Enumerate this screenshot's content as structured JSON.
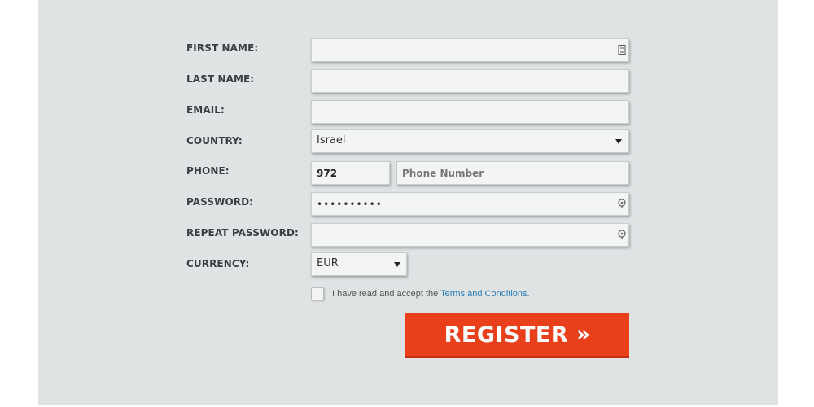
{
  "form": {
    "first_name": {
      "label": "FIRST NAME:",
      "value": ""
    },
    "last_name": {
      "label": "LAST NAME:",
      "value": ""
    },
    "email": {
      "label": "EMAIL:",
      "value": ""
    },
    "country": {
      "label": "COUNTRY:",
      "value": "Israel"
    },
    "phone": {
      "label": "PHONE:",
      "code": "972",
      "placeholder": "Phone Number"
    },
    "password": {
      "label": "PASSWORD:",
      "value": "••••••••••"
    },
    "repeat_password": {
      "label": "REPEAT PASSWORD:",
      "value": ""
    },
    "currency": {
      "label": "CURRENCY:",
      "value": "EUR"
    },
    "terms": {
      "prefix": "I have read and accept the ",
      "link": "Terms and Conditions."
    },
    "register_label": "REGISTER",
    "register_chevron": "»"
  },
  "colors": {
    "accent": "#e93f1a",
    "link": "#2e7db7",
    "panel_bg": "#dfe3e4"
  },
  "icons": [
    "contact-card-icon",
    "key-icon",
    "key-icon",
    "dropdown-caret-icon",
    "double-chevron-right-icon"
  ]
}
